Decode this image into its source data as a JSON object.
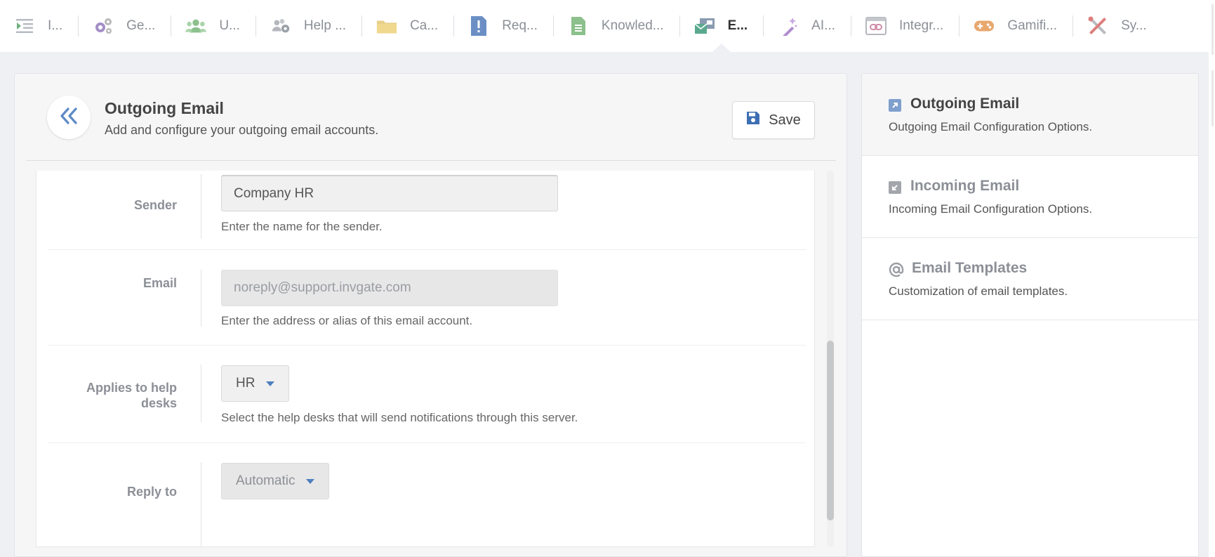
{
  "nav": {
    "items": [
      {
        "label": "I...",
        "icon": "indent-list-icon"
      },
      {
        "label": "Ge...",
        "icon": "gears-icon"
      },
      {
        "label": "U...",
        "icon": "users-icon"
      },
      {
        "label": "Help ...",
        "icon": "users-gear-icon"
      },
      {
        "label": "Ca...",
        "icon": "folder-icon"
      },
      {
        "label": "Req...",
        "icon": "request-file-icon"
      },
      {
        "label": "Knowled...",
        "icon": "document-icon"
      },
      {
        "label": "E...",
        "icon": "email-config-icon"
      },
      {
        "label": "AI...",
        "icon": "magic-wand-icon"
      },
      {
        "label": "Integr...",
        "icon": "integration-link-icon"
      },
      {
        "label": "Gamifi...",
        "icon": "gamepad-icon"
      },
      {
        "label": "Sy...",
        "icon": "tools-icon"
      }
    ]
  },
  "panel": {
    "title": "Outgoing Email",
    "subtitle": "Add and configure your outgoing email accounts.",
    "save_label": "Save"
  },
  "form": {
    "sender": {
      "label": "Sender",
      "value": "Company HR",
      "help": "Enter the name for the sender."
    },
    "email": {
      "label": "Email",
      "value": "noreply@support.invgate.com",
      "help": "Enter the address or alias of this email account."
    },
    "helpdesks": {
      "label": "Applies to help desks",
      "value": "HR",
      "help": "Select the help desks that will send notifications through this server."
    },
    "reply_to": {
      "label": "Reply to",
      "value": "Automatic"
    }
  },
  "side": {
    "items": [
      {
        "title": "Outgoing Email",
        "desc": "Outgoing Email Configuration Options.",
        "icon": "outgoing-arrow-icon"
      },
      {
        "title": "Incoming Email",
        "desc": "Incoming Email Configuration Options.",
        "icon": "incoming-arrow-icon"
      },
      {
        "title": "Email Templates",
        "desc": "Customization of email templates.",
        "icon": "at-sign-icon"
      }
    ]
  },
  "colors": {
    "accent": "#4d7fbf",
    "nav_active_text": "#333333",
    "nav_inactive_text": "#8b8f96"
  }
}
